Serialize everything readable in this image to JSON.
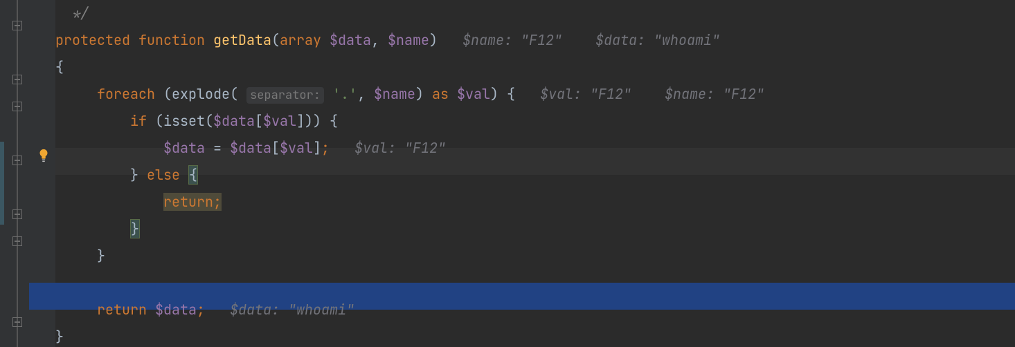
{
  "code": {
    "line0": "*/",
    "protected": "protected",
    "function": "function",
    "fn_name": "getData",
    "paren_open": "(",
    "array_kw": "array",
    "sp": " ",
    "param1": "$data",
    "comma": ",",
    "param2": "$name",
    "paren_close": ")",
    "brace_open": "{",
    "brace_close": "}",
    "foreach": "foreach",
    "explode": "explode",
    "sep_hint": "separator:",
    "dot_str": "'.'",
    "as": "as",
    "val": "$val",
    "if": "if",
    "isset": "isset",
    "lbrack": "[",
    "rbrack": "]",
    "assign": " = ",
    "semi": ";",
    "else": "else",
    "return": "return",
    "data": "$data"
  },
  "inlays": {
    "sig_name": "$name: \"F12\"",
    "sig_data": "$data: \"whoami\"",
    "loop_val": "$val: \"F12\"",
    "loop_name": "$name: \"F12\"",
    "assign_val": "$val: \"F12\"",
    "ret_data": "$data: \"whoami\""
  }
}
